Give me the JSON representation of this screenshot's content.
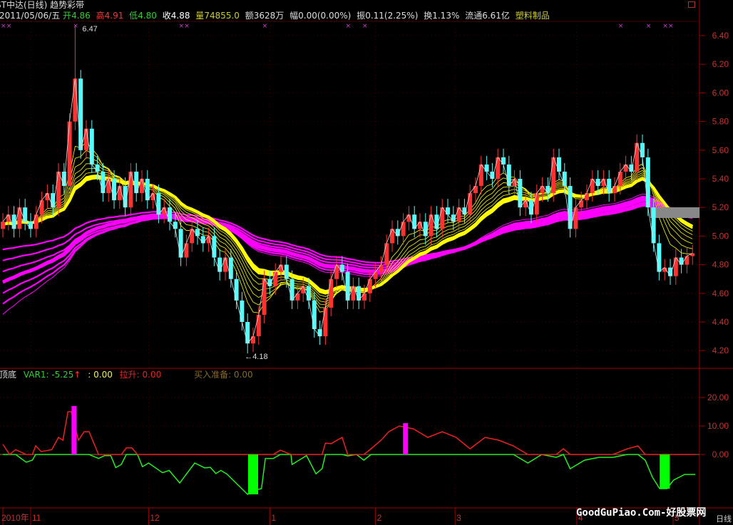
{
  "header": {
    "title": "ST中达(日线) 趋势彩带",
    "date": "2011/05/06/五",
    "open_label": "开",
    "open": "4.86",
    "high_label": "高",
    "high": "4.91",
    "low_label": "低",
    "low": "4.80",
    "close_label": "收",
    "close": "4.88",
    "volume_label": "量",
    "volume": "74855.0",
    "amount": "额3628万",
    "change": "幅0.00(0.00%)",
    "amplitude": "振0.11(2.25%)",
    "turnover": "换1.13%",
    "float": "流通6.61亿",
    "sector": "塑料制品"
  },
  "indicator_header": {
    "name": "顶底",
    "var1": "VAR1: -5.25",
    "arrow": "↑",
    "value2": ": 0.00",
    "lift": "拉升: 0.00",
    "buy": "买入准备: 0.00"
  },
  "watermark": "GoodGuPiao.Com-好股票网",
  "period_label": "日线",
  "colors": {
    "up": "#ff3232",
    "down": "#54fcfc",
    "yellow": "#ffff00",
    "magenta": "#ff00ff",
    "grid": "#800000",
    "axis_text": "#c83232"
  },
  "chart_data": [
    {
      "type": "candlestick",
      "title": "ST中达(日线) 趋势彩带",
      "ylim": [
        4.2,
        6.4
      ],
      "yticks": [
        "6.40",
        "6.20",
        "6.00",
        "5.80",
        "5.60",
        "5.40",
        "5.20",
        "5.00",
        "4.80",
        "4.60",
        "4.40",
        "4.20"
      ],
      "close": [
        5.1,
        5.15,
        5.05,
        5.2,
        5.1,
        5.05,
        5.15,
        5.25,
        5.3,
        5.2,
        5.45,
        5.35,
        5.8,
        6.1,
        5.6,
        5.75,
        5.5,
        5.45,
        5.3,
        5.4,
        5.25,
        5.35,
        5.2,
        5.45,
        5.3,
        5.4,
        5.25,
        5.3,
        5.15,
        5.2,
        5.1,
        5.05,
        4.85,
        4.95,
        5.05,
        5.0,
        4.95,
        5.0,
        4.85,
        4.75,
        4.85,
        4.7,
        4.55,
        4.4,
        4.25,
        4.3,
        4.45,
        4.7,
        4.65,
        4.75,
        4.8,
        4.7,
        4.55,
        4.6,
        4.65,
        4.55,
        4.35,
        4.3,
        4.5,
        4.7,
        4.8,
        4.75,
        4.55,
        4.65,
        4.55,
        4.6,
        4.7,
        4.75,
        4.8,
        4.95,
        5.05,
        5.0,
        5.1,
        5.15,
        5.05,
        5.1,
        5.0,
        5.15,
        5.05,
        5.2,
        5.15,
        5.1,
        5.2,
        5.15,
        5.3,
        5.35,
        5.5,
        5.45,
        5.4,
        5.55,
        5.5,
        5.35,
        5.4,
        5.2,
        5.25,
        5.15,
        5.3,
        5.35,
        5.3,
        5.55,
        5.45,
        5.35,
        5.05,
        5.2,
        5.25,
        5.3,
        5.4,
        5.35,
        5.4,
        5.3,
        5.35,
        5.45,
        5.5,
        5.45,
        5.65,
        5.55,
        5.2,
        4.95,
        4.75,
        4.78,
        4.72,
        4.85,
        4.8,
        4.86,
        4.88
      ],
      "extremes": [
        {
          "index": 13,
          "value": 6.47,
          "label": "6.47"
        },
        {
          "index": 44,
          "value": 4.18,
          "label": "←4.18"
        }
      ],
      "xticks": [
        {
          "index": 0,
          "label": "2010年"
        },
        {
          "index": 5,
          "label": "11"
        },
        {
          "index": 26.2,
          "label": "12"
        },
        {
          "index": 48,
          "label": "1"
        },
        {
          "index": 67,
          "label": "2"
        },
        {
          "index": 81.3,
          "label": "3"
        },
        {
          "index": 103.2,
          "label": "4"
        },
        {
          "index": 120.5,
          "label": "5"
        }
      ],
      "signal_marks": [
        0,
        1,
        13,
        32,
        33,
        47,
        62,
        65,
        111,
        116,
        119,
        120
      ]
    },
    {
      "type": "line",
      "title": "顶底",
      "ylim": [
        -25,
        25
      ],
      "yticks": [
        "20.00",
        "10.00",
        "0.00"
      ],
      "points": [
        [
          0,
          3.6
        ],
        [
          1.2,
          0
        ],
        [
          2.3,
          1.7
        ],
        [
          4.2,
          -2.7
        ],
        [
          5.3,
          -2
        ],
        [
          5.9,
          3
        ],
        [
          6.9,
          1
        ],
        [
          8.8,
          1.7
        ],
        [
          10,
          6
        ],
        [
          10.8,
          5
        ],
        [
          11.7,
          15
        ],
        [
          12.3,
          15
        ],
        [
          13.6,
          5
        ],
        [
          14.6,
          8
        ],
        [
          15.5,
          8
        ],
        [
          17.2,
          -1.4
        ],
        [
          18.3,
          -0.4
        ],
        [
          19.4,
          -0.4
        ],
        [
          20.3,
          -4.6
        ],
        [
          21.3,
          -3.5
        ],
        [
          22.2,
          2.3
        ],
        [
          23.2,
          2.3
        ],
        [
          24.2,
          0
        ],
        [
          25.1,
          -4.3
        ],
        [
          26.2,
          -3
        ],
        [
          28.7,
          -6.4
        ],
        [
          29.9,
          -5.6
        ],
        [
          31.8,
          -10
        ],
        [
          34.5,
          -3
        ],
        [
          36.3,
          -4.7
        ],
        [
          37.3,
          -4.5
        ],
        [
          38.3,
          -6.7
        ],
        [
          39.2,
          -5.6
        ],
        [
          40.3,
          -6.9
        ],
        [
          44,
          -14
        ],
        [
          44.7,
          -12.7
        ],
        [
          46.5,
          -12
        ],
        [
          47.2,
          -1.4
        ],
        [
          48.6,
          -1.4
        ],
        [
          49.9,
          1.5
        ],
        [
          51.8,
          0
        ],
        [
          52,
          -3.5
        ],
        [
          54.6,
          -0.4
        ],
        [
          56.3,
          -6.8
        ],
        [
          57.4,
          -5
        ],
        [
          58,
          4
        ],
        [
          59,
          3.8
        ],
        [
          61,
          6
        ],
        [
          62,
          -0.5
        ],
        [
          63.6,
          0
        ],
        [
          64.9,
          -2
        ],
        [
          66.2,
          2
        ],
        [
          68,
          5
        ],
        [
          69.4,
          8
        ],
        [
          71.3,
          10
        ],
        [
          73.8,
          9
        ],
        [
          76.4,
          6
        ],
        [
          79,
          8
        ],
        [
          81.5,
          6
        ],
        [
          84,
          2
        ],
        [
          86.7,
          6
        ],
        [
          89.2,
          5
        ],
        [
          91.8,
          3
        ],
        [
          94.4,
          -3
        ],
        [
          96.9,
          0
        ],
        [
          99.5,
          -1
        ],
        [
          100.8,
          2
        ],
        [
          102,
          -5
        ],
        [
          104.6,
          -2
        ],
        [
          107.2,
          -1
        ],
        [
          109.7,
          -1
        ],
        [
          112.3,
          2
        ],
        [
          114.2,
          3
        ],
        [
          115.5,
          -2
        ],
        [
          116.8,
          -8
        ],
        [
          118.1,
          -12
        ],
        [
          119.4,
          -12
        ],
        [
          120.6,
          -9
        ],
        [
          122.6,
          -7
        ],
        [
          124.5,
          -7
        ]
      ],
      "bars": [
        {
          "index": 12.8,
          "value": 17,
          "color": "#ff00ff"
        },
        {
          "index": 45,
          "value": -14,
          "color": "#00ff00"
        },
        {
          "index": 72.4,
          "value": 11,
          "color": "#ff00ff"
        },
        {
          "index": 119,
          "value": -12,
          "color": "#00ff00"
        }
      ]
    }
  ]
}
